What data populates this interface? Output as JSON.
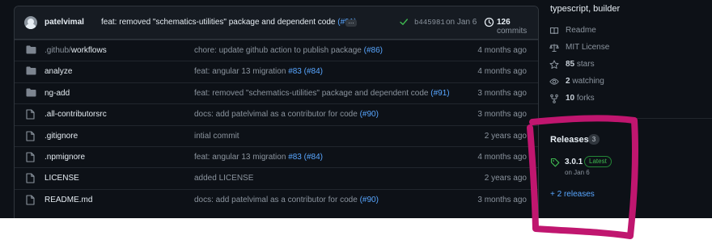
{
  "latest_commit": {
    "author": "patelvimal",
    "message": "feat: removed \"schematics-utilities\" package and dependent code",
    "pr": "(#91)",
    "ellipsis": "…",
    "sha": "b445981",
    "date": "on Jan 6",
    "count": "126",
    "count_label": "commits"
  },
  "files": [
    {
      "type": "dir",
      "name_dim": ".github/",
      "name": "workflows",
      "message": "chore: update github action to publish package ",
      "pr": "(#86)",
      "age": "4 months ago"
    },
    {
      "type": "dir",
      "name_dim": "",
      "name": "analyze",
      "message": "feat: angular 13 migration ",
      "pr": "#83 (#84)",
      "age": "4 months ago"
    },
    {
      "type": "dir",
      "name_dim": "",
      "name": "ng-add",
      "message": "feat: removed \"schematics-utilities\" package and dependent code ",
      "pr": "(#91)",
      "age": "3 months ago"
    },
    {
      "type": "file",
      "name_dim": "",
      "name": ".all-contributorsrc",
      "message": "docs: add patelvimal as a contributor for code ",
      "pr": "(#90)",
      "age": "3 months ago"
    },
    {
      "type": "file",
      "name_dim": "",
      "name": ".gitignore",
      "message": "intial commit",
      "pr": "",
      "age": "2 years ago"
    },
    {
      "type": "file",
      "name_dim": "",
      "name": ".npmignore",
      "message": "feat: angular 13 migration ",
      "pr": "#83 (#84)",
      "age": "4 months ago"
    },
    {
      "type": "file",
      "name_dim": "",
      "name": "LICENSE",
      "message": "added LICENSE",
      "pr": "",
      "age": "2 years ago"
    },
    {
      "type": "file",
      "name_dim": "",
      "name": "README.md",
      "message": "docs: add patelvimal as a contributor for code ",
      "pr": "(#90)",
      "age": "3 months ago"
    }
  ],
  "sidebar": {
    "topics": "typescript, builder",
    "items": [
      {
        "icon": "book-icon",
        "value": "",
        "label": "Readme"
      },
      {
        "icon": "law-icon",
        "value": "",
        "label": "MIT License"
      },
      {
        "icon": "star-icon",
        "value": "85",
        "label": " stars"
      },
      {
        "icon": "eye-icon",
        "value": "2",
        "label": " watching"
      },
      {
        "icon": "fork-icon",
        "value": "10",
        "label": " forks"
      }
    ],
    "releases": {
      "heading": "Releases",
      "count": "3",
      "version": "3.0.1",
      "badge": "Latest",
      "date": "on Jan 6",
      "more": "+ 2 releases"
    }
  },
  "colors": {
    "background": "#0d1117",
    "link": "#58a6ff",
    "highlight": "#c0166f",
    "folder": "#7d8590",
    "success": "#3fb950"
  }
}
